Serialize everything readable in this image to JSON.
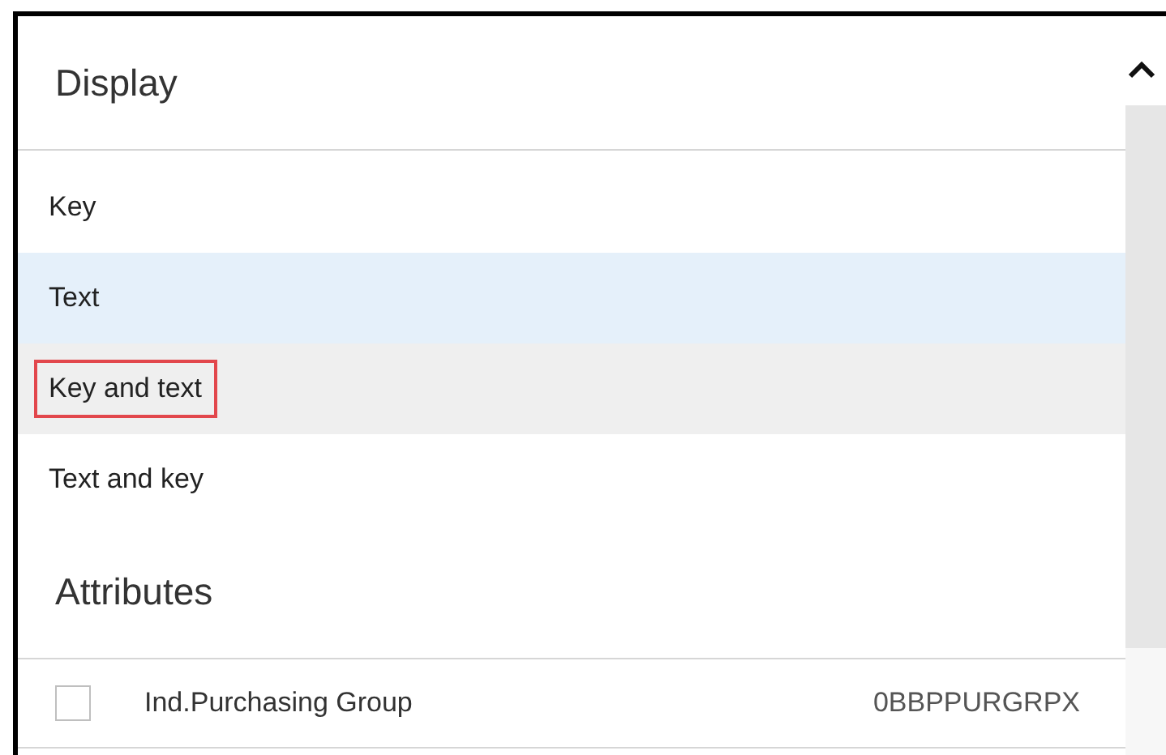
{
  "display": {
    "title": "Display",
    "options": [
      {
        "label": "Key",
        "selected": false,
        "hovered": false,
        "outlined": false
      },
      {
        "label": "Text",
        "selected": true,
        "hovered": false,
        "outlined": false
      },
      {
        "label": "Key and text",
        "selected": false,
        "hovered": true,
        "outlined": true
      },
      {
        "label": "Text and key",
        "selected": false,
        "hovered": false,
        "outlined": false
      }
    ]
  },
  "attributes": {
    "title": "Attributes",
    "items": [
      {
        "label": "Ind.Purchasing Group",
        "key": "0BBPPURGRPX",
        "checked": false
      }
    ]
  }
}
